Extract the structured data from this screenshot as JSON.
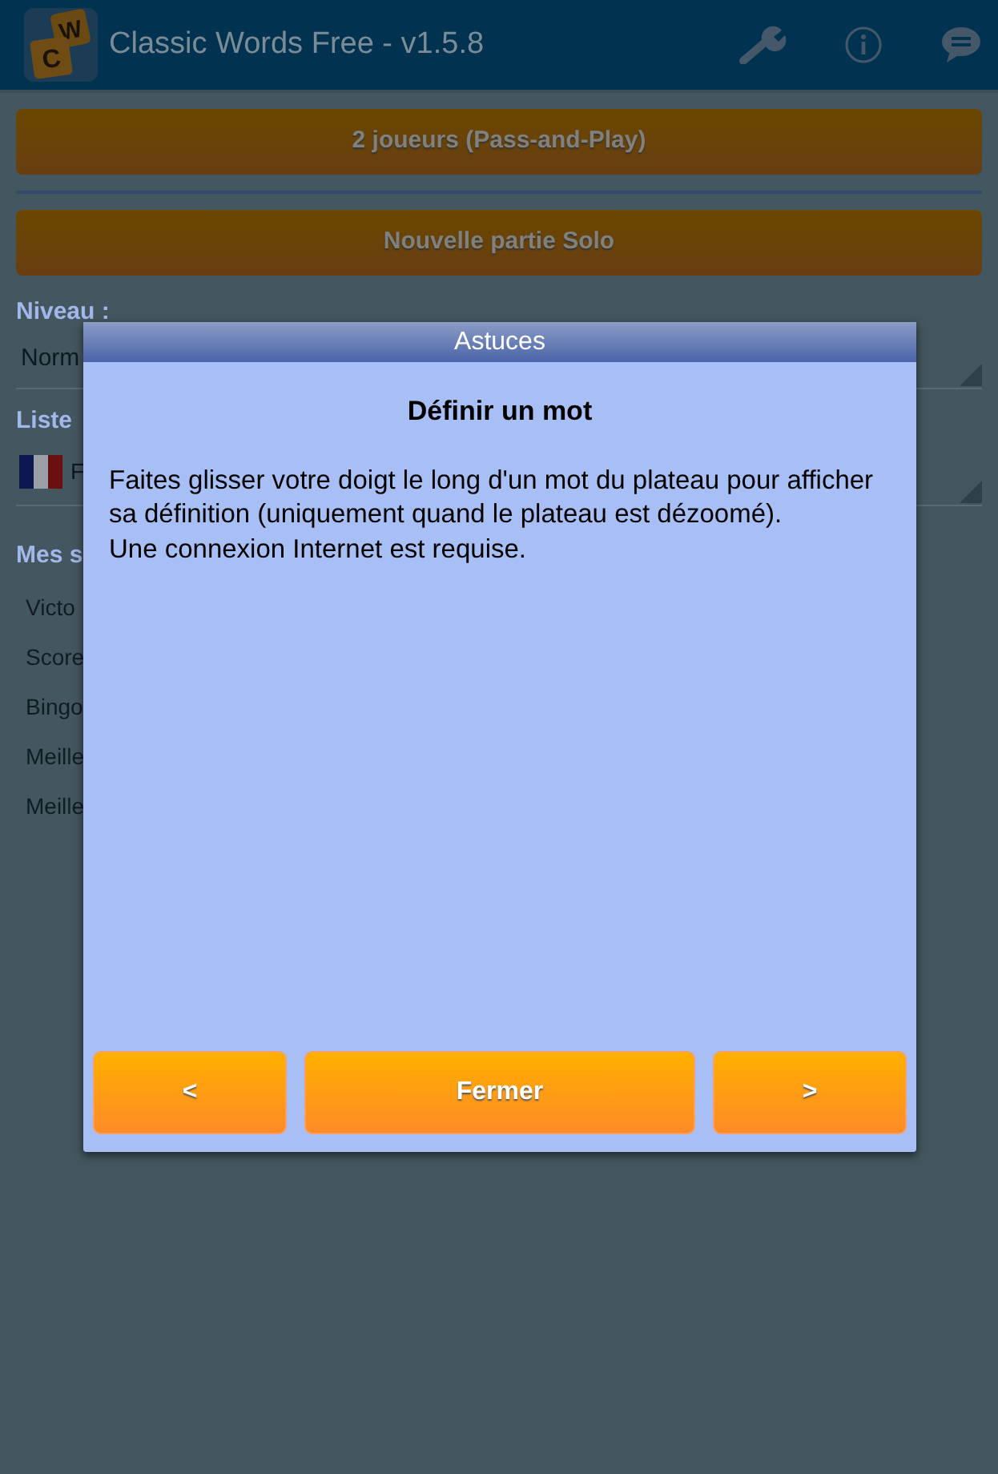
{
  "app_bar": {
    "logo_letters": [
      "W",
      "C"
    ],
    "title": "Classic Words Free - v1.5.8"
  },
  "menu_buttons": [
    "2 joueurs (Pass-and-Play)",
    "Nouvelle partie Solo"
  ],
  "level": {
    "label": "Niveau :",
    "value": "Norm"
  },
  "word_list": {
    "label": "Liste",
    "value": "F"
  },
  "stats": {
    "label": "Mes s",
    "items": [
      "Victo",
      "Score",
      "Bingo",
      "Meille",
      "Meille"
    ]
  },
  "dialog": {
    "title": "Astuces",
    "heading": "Définir un mot",
    "paragraphs": [
      "Faites glisser votre doigt le long d'un mot du plateau pour afficher sa définition (uniquement quand le plateau est dézoomé).",
      "Une connexion Internet est requise."
    ],
    "buttons": [
      {
        "label": "<",
        "kind": "prev"
      },
      {
        "label": "Fermer",
        "kind": "close"
      },
      {
        "label": ">",
        "kind": "next"
      }
    ]
  }
}
